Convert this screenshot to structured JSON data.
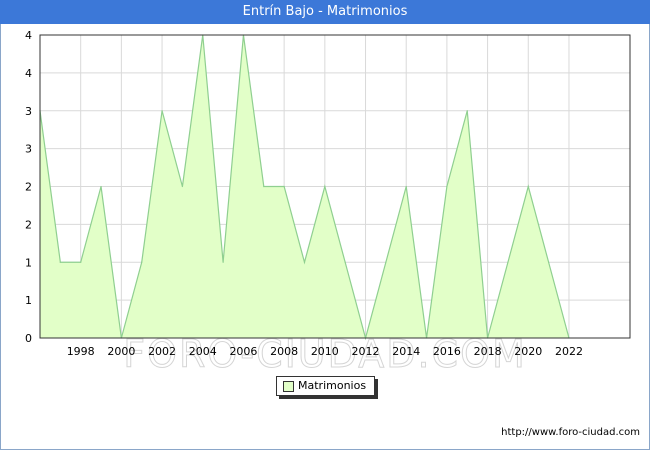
{
  "title": "Entrín Bajo - Matrimonios",
  "watermark": "FORO-CIUDAD.COM",
  "source_url": "http://www.foro-ciudad.com",
  "colors": {
    "title_bg": "#3c78d8",
    "area_fill": "#e2ffc8",
    "area_line": "#8fcf90",
    "grid": "#d9d9d9"
  },
  "chart_data": {
    "type": "area",
    "x": [
      1996,
      1997,
      1998,
      1999,
      2000,
      2001,
      2002,
      2003,
      2004,
      2005,
      2006,
      2007,
      2008,
      2009,
      2010,
      2011,
      2012,
      2013,
      2014,
      2015,
      2016,
      2017,
      2018,
      2019,
      2020,
      2021,
      2022
    ],
    "series": [
      {
        "name": "Matrimonios",
        "values": [
          3,
          1,
          1,
          2,
          0,
          1,
          3,
          2,
          4,
          1,
          4,
          2,
          2,
          1,
          2,
          1,
          0,
          1,
          2,
          0,
          2,
          3,
          0,
          1,
          2,
          1,
          0
        ]
      }
    ],
    "xlim": [
      1996,
      2025
    ],
    "ylim": [
      0,
      4
    ],
    "x_ticks": [
      "1998",
      "2000",
      "2002",
      "2004",
      "2006",
      "2008",
      "2010",
      "2012",
      "2014",
      "2016",
      "2018",
      "2020",
      "2022"
    ],
    "y_ticks": [
      "0",
      "1",
      "1",
      "2",
      "2",
      "3",
      "3",
      "4",
      "4"
    ],
    "grid": true,
    "legend": {
      "position": "bottom-center",
      "label": "Matrimonios"
    }
  }
}
